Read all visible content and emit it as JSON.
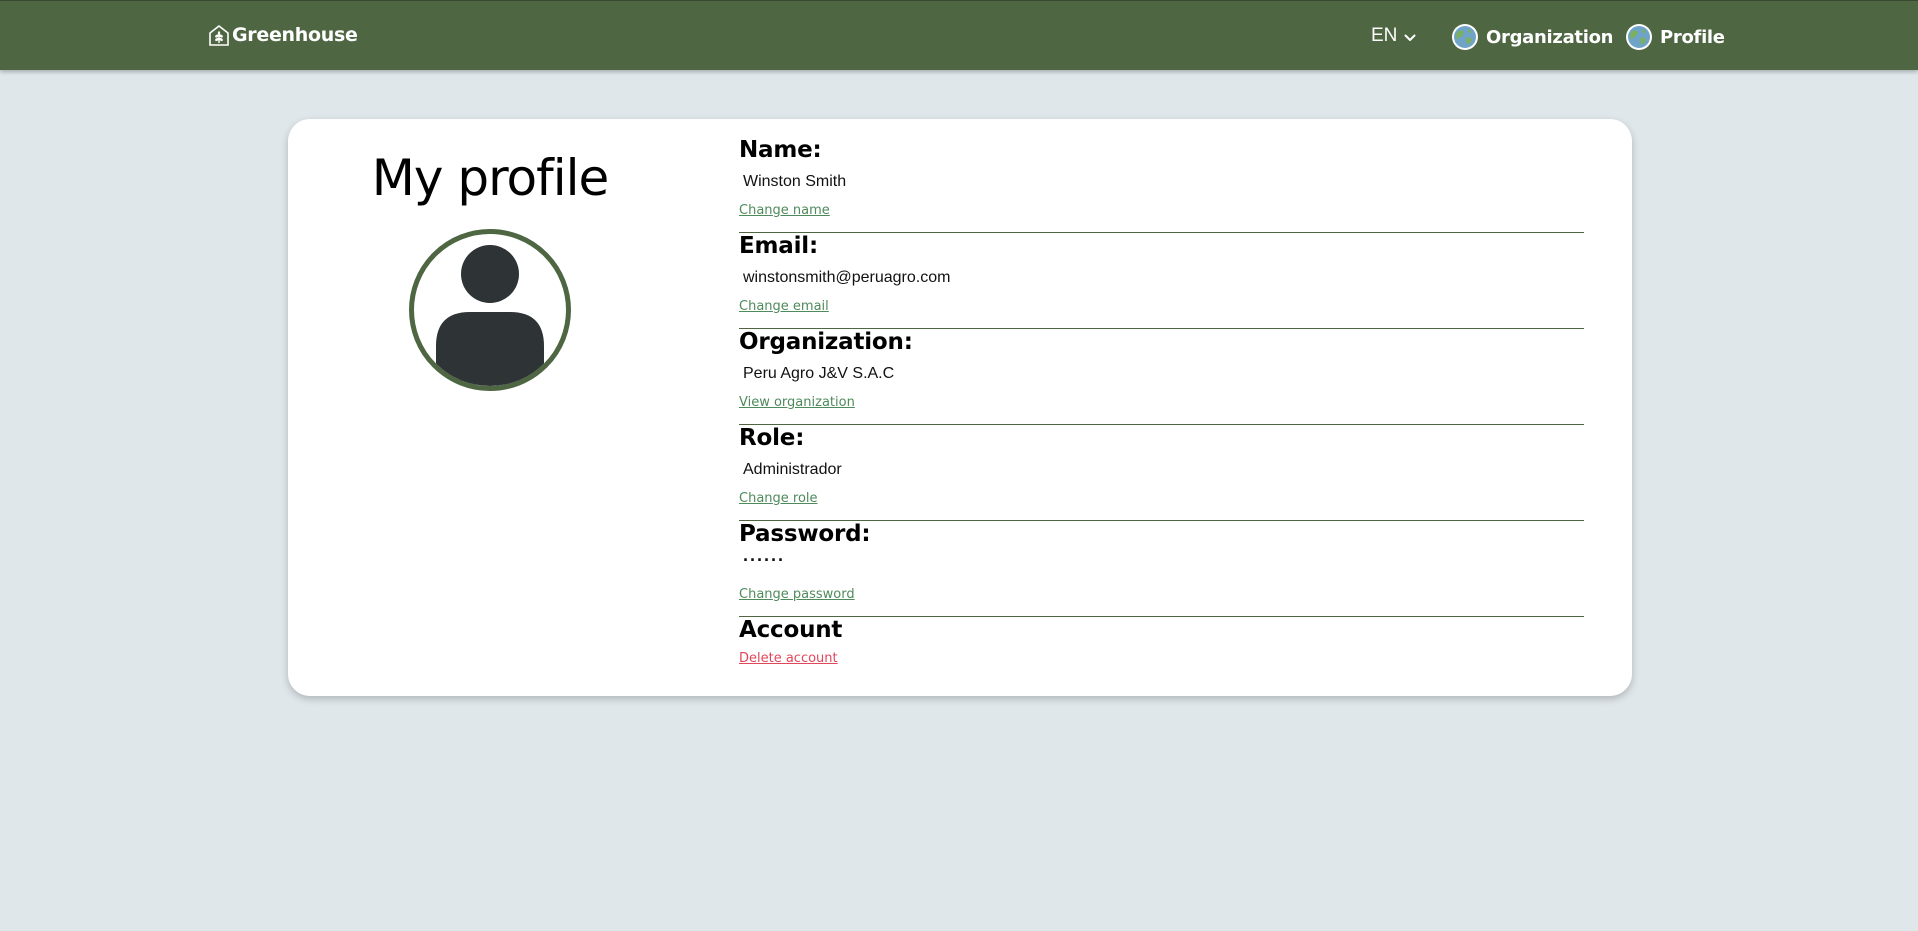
{
  "navbar": {
    "brand": "Greenhouse",
    "language": "EN",
    "organization_label": "Organization",
    "profile_label": "Profile"
  },
  "profile": {
    "title": "My profile",
    "fields": {
      "name": {
        "label": "Name:",
        "value": "Winston Smith",
        "action": "Change name"
      },
      "email": {
        "label": "Email:",
        "value": "winstonsmith@peruagro.com",
        "action": "Change email"
      },
      "organization": {
        "label": "Organization:",
        "value": "Peru Agro J&V S.A.C",
        "action": "View organization"
      },
      "role": {
        "label": "Role:",
        "value": "Administrador",
        "action": "Change role"
      },
      "password": {
        "label": "Password:",
        "value": "······",
        "action": "Change password"
      },
      "account": {
        "label": "Account",
        "action": "Delete account"
      }
    }
  },
  "colors": {
    "navbar": "#4e6642",
    "background": "#e0e7eb",
    "link": "#4e8a5b",
    "danger": "#e0475a"
  },
  "icons": {
    "brand": "greenhouse-leaf-icon",
    "language": "chevron-down-icon",
    "organization": "globe-icon",
    "profile": "globe-icon",
    "avatar": "user-silhouette-icon"
  }
}
